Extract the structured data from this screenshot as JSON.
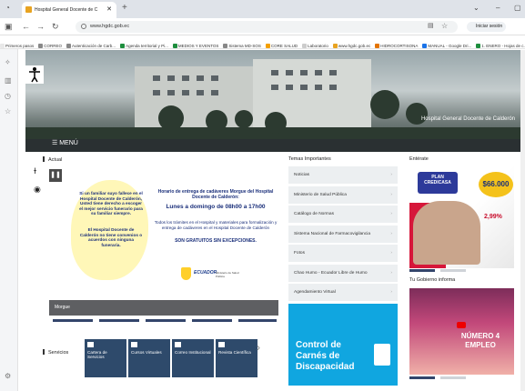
{
  "browser": {
    "tab_title": "Hospital General Docente de C",
    "tab_close": "✕",
    "new_tab": "+",
    "url": "www.hgdc.gob.ec",
    "profile": "Iniciar sesión",
    "bookmarks": [
      {
        "label": "Primeros pasos",
        "color": "#e8e8e8"
      },
      {
        "label": "CORREO",
        "color": "#888"
      },
      {
        "label": "Autenticación de Carb...",
        "color": "#888"
      },
      {
        "label": "Agenda territorial y Pi...",
        "color": "#1e8e3e"
      },
      {
        "label": "MEDIOS Y EVENTOS",
        "color": "#1e8e3e"
      },
      {
        "label": "Sistema MD-SOS",
        "color": "#888"
      },
      {
        "label": "CORE SALUD",
        "color": "#f4a000"
      },
      {
        "label": "Laboratorio",
        "color": "#ccc"
      },
      {
        "label": "www.hgdc.gob.ec",
        "color": "#e8a321"
      },
      {
        "label": "HIDROCORTISONA",
        "color": "#e37400"
      },
      {
        "label": "MANUAL - Google Dri...",
        "color": "#1a73e8"
      },
      {
        "label": "1. ENERO - Hojas de c...",
        "color": "#1e8e3e"
      }
    ]
  },
  "hero": {
    "title": "Hospital General Docente de Calderón",
    "menu_label": "☰ MENÚ"
  },
  "sections": {
    "actual": "Actual",
    "temas": "Temas Importantes",
    "enterate": "Entérate",
    "gobierno": "Tu Gobierno informa",
    "servicios": "Servicios"
  },
  "notice": {
    "left_1": "Si un familiar suyo fallece en el Hospital Docente de Calderón, Usted tiene derecho a escoger el mejor servicio funerario para su familiar siempre.",
    "left_2": "El Hospital Docente de Calderón no tiene convenios o acuerdos con ninguna funeraria.",
    "right_title": "Horario de entrega de cadáveres Morgue del Hospital Docente de Calderón:",
    "right_hours": "Lunes a domingo de 08h00 a 17h00",
    "right_body": "Todos los trámites en el Hospital y materiales para formalización y entrega de cadáveres en el Hospital Docente de Calderón",
    "right_free": "SON GRATUITOS SIN EXCEPCIONES.",
    "logo_text": "ECUADOR",
    "logo_sub": "Ministerio de Salud Pública",
    "caption": "Morgue"
  },
  "servicios": [
    {
      "label": "Cartera de Servicios",
      "icon": "folder-icon"
    },
    {
      "label": "Cursos Virtuales",
      "icon": "user-icon"
    },
    {
      "label": "Correo Institucional",
      "icon": "mail-icon"
    },
    {
      "label": "Revista Científica",
      "icon": "document-icon"
    }
  ],
  "temas": [
    "Noticias",
    "Ministerio de Salud Pública",
    "Catálogo de Normas",
    "Sistema Nacional de Farmacovigilancia",
    "Fotos",
    "Chao Humo - Ecuador Libre de Humo",
    "Agendamiento Virtual"
  ],
  "ad": {
    "text": "Control de Carnés de Discapacidad"
  },
  "promo": {
    "plan": "PLAN CREDICASA",
    "amount": "$66.000",
    "rate": "2,99%"
  },
  "video": {
    "text": "NÚMERO 4 EMPLEO"
  }
}
